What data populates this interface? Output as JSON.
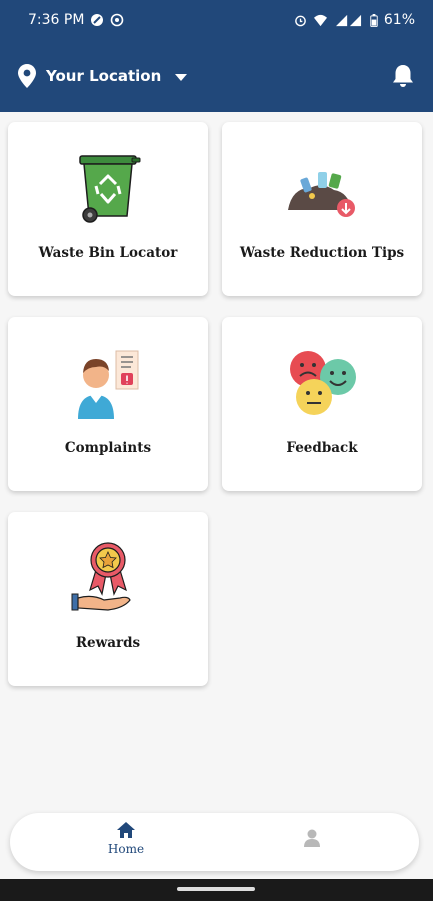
{
  "status_bar": {
    "time": "7:36 PM",
    "battery": "61%",
    "icons": [
      "notification-icon",
      "whatsapp-icon",
      "alarm-icon",
      "wifi-icon",
      "signal-icon",
      "battery-icon"
    ]
  },
  "header": {
    "location_label": "Your Location",
    "icons": {
      "location": "location-pin-icon",
      "dropdown": "chevron-down-icon",
      "notification": "bell-icon"
    },
    "bg_color": "#21487a"
  },
  "cards": [
    {
      "label": "Waste Bin Locator",
      "icon": "recycle-bin-icon"
    },
    {
      "label": "Waste Reduction Tips",
      "icon": "waste-reduction-icon"
    },
    {
      "label": "Complaints",
      "icon": "complaint-icon"
    },
    {
      "label": "Feedback",
      "icon": "feedback-faces-icon"
    },
    {
      "label": "Rewards",
      "icon": "reward-badge-icon"
    }
  ],
  "bottom_nav": {
    "home_label": "Home",
    "icons": {
      "home": "home-icon",
      "profile": "user-icon"
    },
    "active_color": "#21487a"
  }
}
